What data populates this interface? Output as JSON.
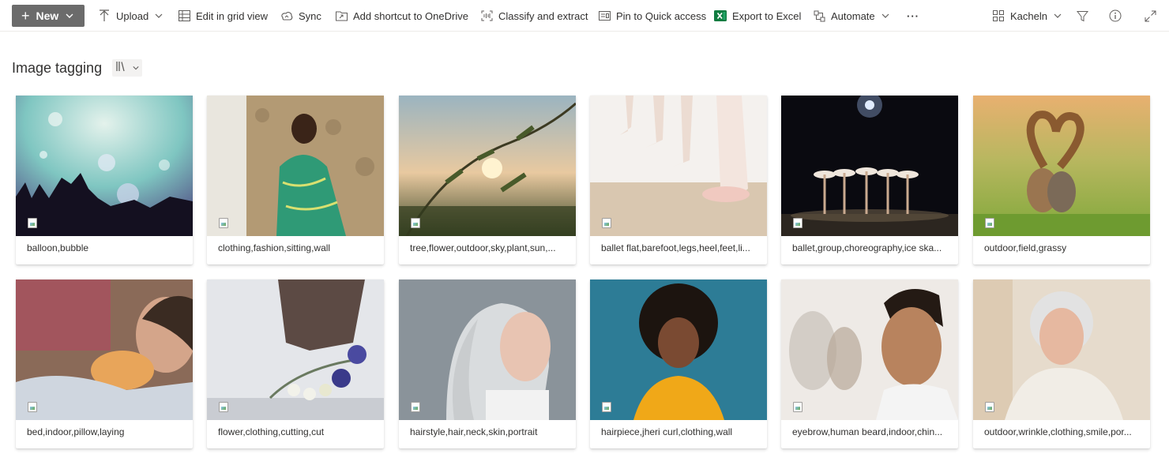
{
  "toolbar": {
    "new_label": "New",
    "upload_label": "Upload",
    "edit_grid_label": "Edit in grid view",
    "sync_label": "Sync",
    "shortcut_label": "Add shortcut to OneDrive",
    "classify_label": "Classify and extract",
    "pin_label": "Pin to Quick access",
    "export_label": "Export to Excel",
    "automate_label": "Automate",
    "more_label": "···",
    "view_label": "Kacheln"
  },
  "page": {
    "title": "Image tagging"
  },
  "tiles": [
    {
      "caption": "balloon,bubble"
    },
    {
      "caption": "clothing,fashion,sitting,wall"
    },
    {
      "caption": "tree,flower,outdoor,sky,plant,sun,..."
    },
    {
      "caption": "ballet flat,barefoot,legs,heel,feet,li..."
    },
    {
      "caption": "ballet,group,choreography,ice ska..."
    },
    {
      "caption": "outdoor,field,grassy"
    },
    {
      "caption": "bed,indoor,pillow,laying"
    },
    {
      "caption": "flower,clothing,cutting,cut"
    },
    {
      "caption": "hairstyle,hair,neck,skin,portrait"
    },
    {
      "caption": "hairpiece,jheri curl,clothing,wall"
    },
    {
      "caption": "eyebrow,human beard,indoor,chin..."
    },
    {
      "caption": "outdoor,wrinkle,clothing,smile,por..."
    }
  ],
  "colors": {
    "new_button": "#6b6b6b",
    "excel_green": "#107c41"
  }
}
